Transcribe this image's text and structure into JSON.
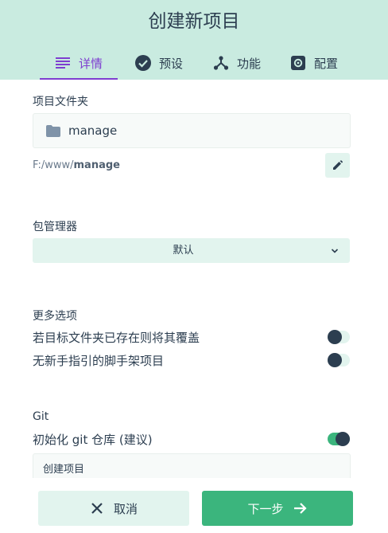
{
  "dialog": {
    "title": "创建新项目"
  },
  "tabs": [
    {
      "label": "详情",
      "icon": "list-icon",
      "active": true
    },
    {
      "label": "预设",
      "icon": "check-circle-icon",
      "active": false
    },
    {
      "label": "功能",
      "icon": "fork-icon",
      "active": false
    },
    {
      "label": "配置",
      "icon": "settings-icon",
      "active": false
    }
  ],
  "folder": {
    "label": "项目文件夹",
    "name": "manage",
    "path_prefix": "F:/www/",
    "path_name": "manage"
  },
  "package_manager": {
    "label": "包管理器",
    "selected": "默认"
  },
  "more_options": {
    "label": "更多选项",
    "items": [
      {
        "label": "若目标文件夹已存在则将其覆盖",
        "enabled": false
      },
      {
        "label": "无新手指引的脚手架项目",
        "enabled": false
      }
    ]
  },
  "git": {
    "label": "Git",
    "init_label": "初始化 git 仓库 (建议)",
    "init_enabled": true,
    "commit_message": "创建项目"
  },
  "footer": {
    "cancel_label": "取消",
    "next_label": "下一步"
  },
  "colors": {
    "header_bg": "#c9ebe0",
    "accent": "#7e3ed0",
    "primary": "#3bb57d",
    "text": "#2c3e50"
  }
}
